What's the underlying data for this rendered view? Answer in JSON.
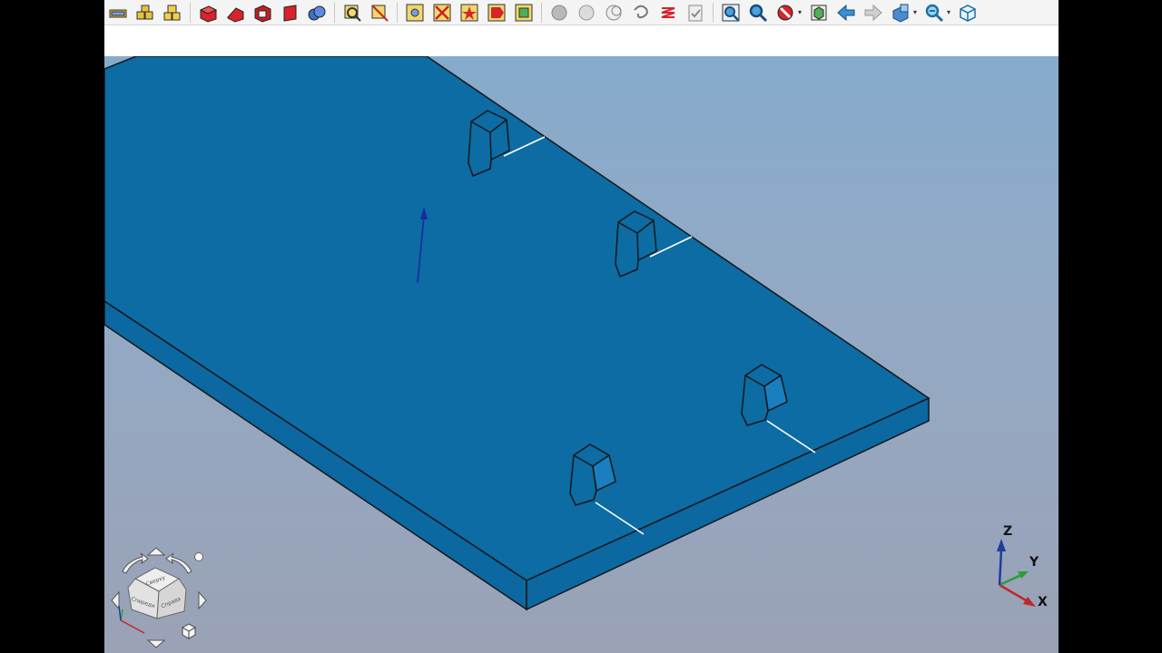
{
  "toolbar": {
    "groups": [
      [
        "assembly-lines-icon",
        "assembly-blocks-icon",
        "assembly-yellow-icon"
      ],
      [
        "red-box-icon",
        "red-wedge-icon",
        "red-shell-icon",
        "red-plate-icon",
        "blue-spheres-icon"
      ],
      [
        "measure-icon",
        "zoom-parts-icon"
      ],
      [
        "select-tree-icon",
        "deselect-icon",
        "mesh-star-icon",
        "mesh-tag-icon",
        "mesh-frame-icon"
      ],
      [
        "ghost-sphere-icon",
        "ghost-sphere2-icon",
        "wire-sphere-icon",
        "spiral-icon",
        "spring-icon",
        "clipboard-icon"
      ],
      [
        "zoom-fit-icon",
        "zoom-icon",
        "no-entry-icon",
        "view-cube-icon",
        "arrow-left-icon",
        "arrow-right-icon",
        "view-box-icon",
        "zoom-out-icon",
        "iso-cube-icon"
      ]
    ]
  },
  "axes": {
    "x": "X",
    "y": "Y",
    "z": "Z"
  },
  "nav_cube": {
    "top_face": "Сверху",
    "left_face": "Спереди",
    "right_face": "Справа"
  },
  "colors": {
    "plate": "#0b6ba1",
    "plate_side": "#0c6ca2",
    "outline": "#15171a",
    "axis_x": "#c0262c",
    "axis_y": "#2f9a3a",
    "axis_z": "#1f3d9c",
    "vector": "#1a2aa0"
  }
}
